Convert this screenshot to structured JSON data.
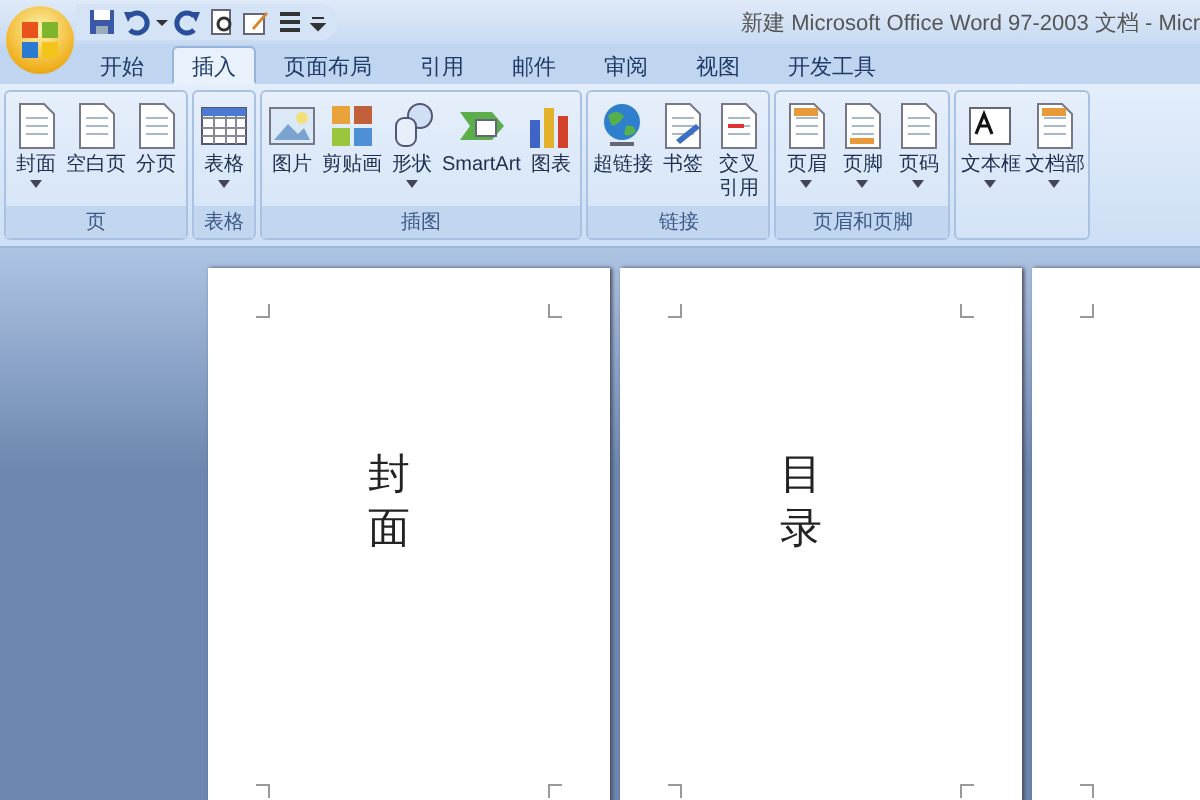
{
  "window": {
    "title": "新建 Microsoft Office Word 97-2003 文档 - Micr"
  },
  "tabs": [
    {
      "label": "开始",
      "selected": false
    },
    {
      "label": "插入",
      "selected": true
    },
    {
      "label": "页面布局",
      "selected": false
    },
    {
      "label": "引用",
      "selected": false
    },
    {
      "label": "邮件",
      "selected": false
    },
    {
      "label": "审阅",
      "selected": false
    },
    {
      "label": "视图",
      "selected": false
    },
    {
      "label": "开发工具",
      "selected": false
    }
  ],
  "groups": [
    {
      "label": "页",
      "buttons": [
        {
          "lines": [
            "封面"
          ],
          "dropdown": true
        },
        {
          "lines": [
            "空白页"
          ],
          "dropdown": false
        },
        {
          "lines": [
            "分页"
          ],
          "dropdown": false
        }
      ]
    },
    {
      "label": "表格",
      "buttons": [
        {
          "lines": [
            "表格"
          ],
          "dropdown": true
        }
      ]
    },
    {
      "label": "插图",
      "buttons": [
        {
          "lines": [
            "图片"
          ],
          "dropdown": false
        },
        {
          "lines": [
            "剪贴画"
          ],
          "dropdown": false
        },
        {
          "lines": [
            "形状"
          ],
          "dropdown": true
        },
        {
          "lines": [
            "SmartArt"
          ],
          "dropdown": false
        },
        {
          "lines": [
            "图表"
          ],
          "dropdown": false
        }
      ]
    },
    {
      "label": "链接",
      "buttons": [
        {
          "lines": [
            "超链接"
          ],
          "dropdown": false
        },
        {
          "lines": [
            "书签"
          ],
          "dropdown": false
        },
        {
          "lines": [
            "交叉",
            "引用"
          ],
          "dropdown": false
        }
      ]
    },
    {
      "label": "页眉和页脚",
      "buttons": [
        {
          "lines": [
            "页眉"
          ],
          "dropdown": true
        },
        {
          "lines": [
            "页脚"
          ],
          "dropdown": true
        },
        {
          "lines": [
            "页码"
          ],
          "dropdown": true
        }
      ]
    },
    {
      "buttons": [
        {
          "lines": [
            "文本框"
          ],
          "dropdown": true
        },
        {
          "lines": [
            "文档部"
          ],
          "dropdown": true
        }
      ]
    }
  ],
  "pages": [
    {
      "text": "封面"
    },
    {
      "text": "目录"
    }
  ]
}
